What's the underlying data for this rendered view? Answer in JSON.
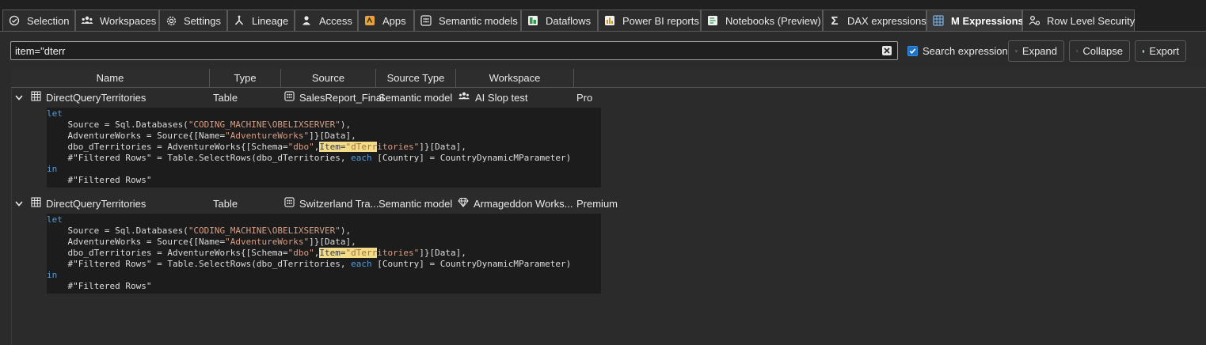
{
  "tabs": [
    {
      "label": "Selection",
      "icon": "check-circle-icon",
      "active": false
    },
    {
      "label": "Workspaces",
      "icon": "people-icon",
      "active": false
    },
    {
      "label": "Settings",
      "icon": "gear-icon",
      "active": false
    },
    {
      "label": "Lineage",
      "icon": "lineage-icon",
      "active": false
    },
    {
      "label": "Access",
      "icon": "person-icon",
      "active": false
    },
    {
      "label": "Apps",
      "icon": "apps-icon",
      "active": false
    },
    {
      "label": "Semantic models",
      "icon": "semantic-model-icon",
      "active": false
    },
    {
      "label": "Dataflows",
      "icon": "dataflow-icon",
      "active": false
    },
    {
      "label": "Power BI reports",
      "icon": "report-icon",
      "active": false
    },
    {
      "label": "Notebooks (Preview)",
      "icon": "notebook-icon",
      "active": false
    },
    {
      "label": "DAX expressions",
      "icon": "sigma-icon",
      "active": false
    },
    {
      "label": "M Expressions",
      "icon": "m-expression-icon",
      "active": true
    },
    {
      "label": "Row Level Security",
      "icon": "row-security-icon",
      "active": false
    }
  ],
  "toolbar": {
    "search_value": "item=\"dterr",
    "search_placeholder": "",
    "search_expressions_label": "Search expressions",
    "search_expressions_checked": true,
    "expand_label": "Expand",
    "collapse_label": "Collapse",
    "export_label": "Export"
  },
  "grid": {
    "columns": [
      "Name",
      "Type",
      "Source",
      "Source Type",
      "Workspace",
      ""
    ],
    "rows": [
      {
        "name": "DirectQueryTerritories",
        "type": "Table",
        "source": "SalesReport_Final",
        "source_type": "Semantic model",
        "workspace": "AI Slop test",
        "workspace_icon": "people-icon",
        "capacity": "Pro",
        "expanded": true,
        "code": {
          "kw_let": "let",
          "line1": "    Source = Sql.Databases(",
          "line1_str": "\"CODING_MACHINE\\OBELIXSERVER\"",
          "line1_end": "),",
          "line2": "    AdventureWorks = Source{[Name=",
          "line2_str": "\"AdventureWorks\"",
          "line2_end": "]}[Data],",
          "line3": "    dbo_dTerritories = AdventureWorks{[Schema=",
          "line3_str": "\"dbo\"",
          "line3_sep": ",",
          "line3_hl_a": "Item=",
          "line3_hl_b": "\"dTerr",
          "line3_str_rest": "itories\"",
          "line3_end": "]}[Data],",
          "line4": "    #\"Filtered Rows\" = Table.SelectRows(dbo_dTerritories, ",
          "line4_kw": "each",
          "line4_end": " [Country] = CountryDynamicMParameter)",
          "kw_in": "in",
          "line6": "    #\"Filtered Rows\""
        }
      },
      {
        "name": "DirectQueryTerritories",
        "type": "Table",
        "source": "Switzerland Tra...",
        "source_type": "Semantic model",
        "workspace": "Armageddon Works...",
        "workspace_icon": "diamond-icon",
        "capacity": "Premium",
        "expanded": true,
        "code": {
          "kw_let": "let",
          "line1": "    Source = Sql.Databases(",
          "line1_str": "\"CODING_MACHINE\\OBELIXSERVER\"",
          "line1_end": "),",
          "line2": "    AdventureWorks = Source{[Name=",
          "line2_str": "\"AdventureWorks\"",
          "line2_end": "]}[Data],",
          "line3": "    dbo_dTerritories = AdventureWorks{[Schema=",
          "line3_str": "\"dbo\"",
          "line3_sep": ",",
          "line3_hl_a": "Item=",
          "line3_hl_b": "\"dTerr",
          "line3_str_rest": "itories\"",
          "line3_end": "]}[Data],",
          "line4": "    #\"Filtered Rows\" = Table.SelectRows(dbo_dTerritories, ",
          "line4_kw": "each",
          "line4_end": " [Country] = CountryDynamicMParameter)",
          "kw_in": "in",
          "line6": "    #\"Filtered Rows\""
        }
      }
    ]
  },
  "colors": {
    "background": "#2b2b2b",
    "tabbar": "#202020",
    "accent": "#1a73c9",
    "highlight": "#f2dc89",
    "code_keyword": "#569cd6",
    "code_string": "#d69d85"
  }
}
